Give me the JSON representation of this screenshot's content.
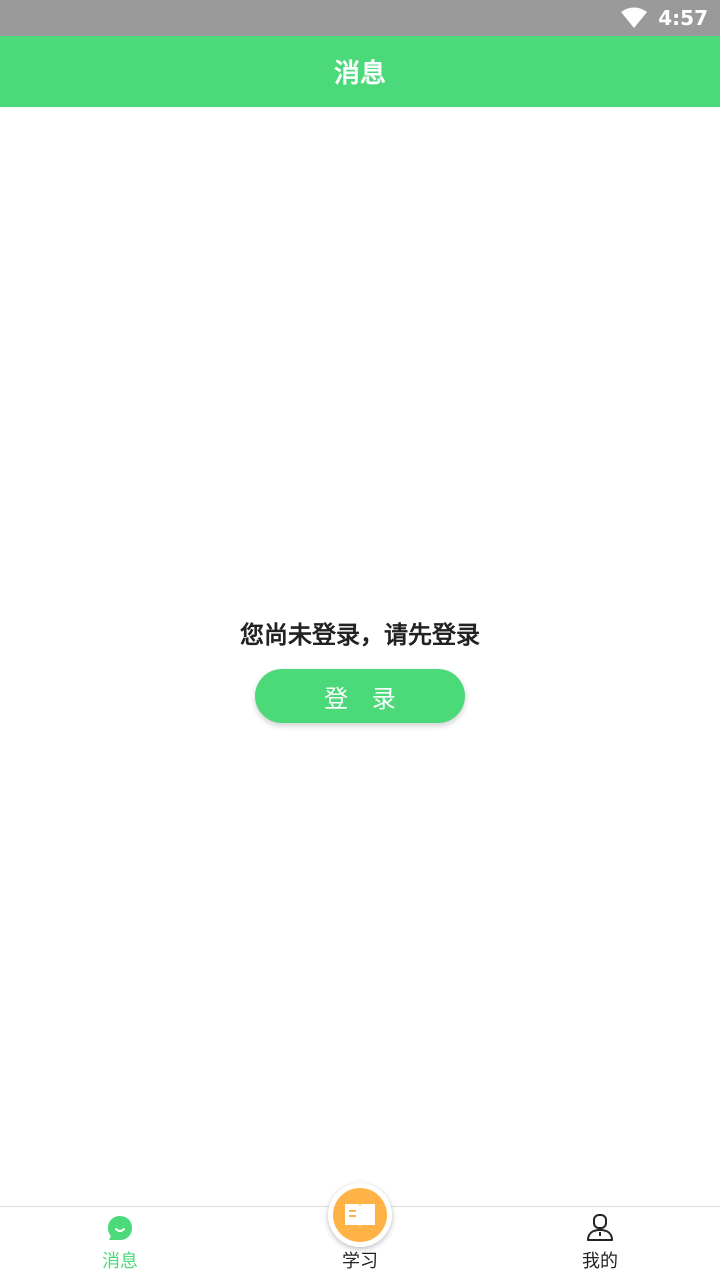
{
  "status_bar": {
    "time": "4:57"
  },
  "app_bar": {
    "title": "消息"
  },
  "content": {
    "prompt": "您尚未登录，请先登录",
    "login_label": "登 录"
  },
  "tabs": [
    {
      "label": "消息",
      "icon": "message-icon",
      "active": true
    },
    {
      "label": "学习",
      "icon": "book-icon",
      "active": false
    },
    {
      "label": "我的",
      "icon": "person-icon",
      "active": false
    }
  ],
  "colors": {
    "primary": "#4cd97a",
    "accent": "#ffb347",
    "status_bar": "#9a9a9a"
  }
}
